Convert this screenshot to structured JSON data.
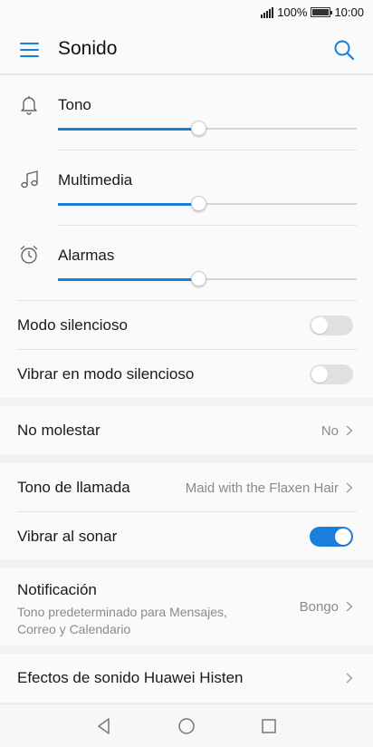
{
  "status": {
    "battery": "100%",
    "time": "10:00"
  },
  "header": {
    "title": "Sonido"
  },
  "icons": {
    "menu": "menu-icon",
    "search": "search-icon",
    "bell": "bell-icon",
    "music": "music-note-icon",
    "alarm": "alarm-clock-icon",
    "chevron": "chevron-right-icon"
  },
  "colors": {
    "accent": "#1a7fdb",
    "text": "#1a1a1a",
    "secondary": "#8a8a8a",
    "background": "#f2f2f2",
    "surface": "#fafafa"
  },
  "volumes": [
    {
      "label": "Tono",
      "level": 0.47
    },
    {
      "label": "Multimedia",
      "level": 0.47
    },
    {
      "label": "Alarmas",
      "level": 0.47
    }
  ],
  "silent_mode": {
    "label": "Modo silencioso",
    "on": false
  },
  "vibrate_silent": {
    "label": "Vibrar en modo silencioso",
    "on": false
  },
  "do_not_disturb": {
    "label": "No molestar",
    "value": "No"
  },
  "ringtone": {
    "label": "Tono de llamada",
    "value": "Maid with the Flaxen Hair"
  },
  "vibrate_ring": {
    "label": "Vibrar al sonar",
    "on": true
  },
  "notification": {
    "label": "Notificación",
    "description": "Tono predeterminado para Mensajes, Correo y Calendario",
    "value": "Bongo"
  },
  "sound_effects": {
    "label": "Efectos de sonido Huawei Histen"
  },
  "navbar": {
    "back": "back-triangle-icon",
    "home": "home-circle-icon",
    "recents": "recents-square-icon"
  }
}
